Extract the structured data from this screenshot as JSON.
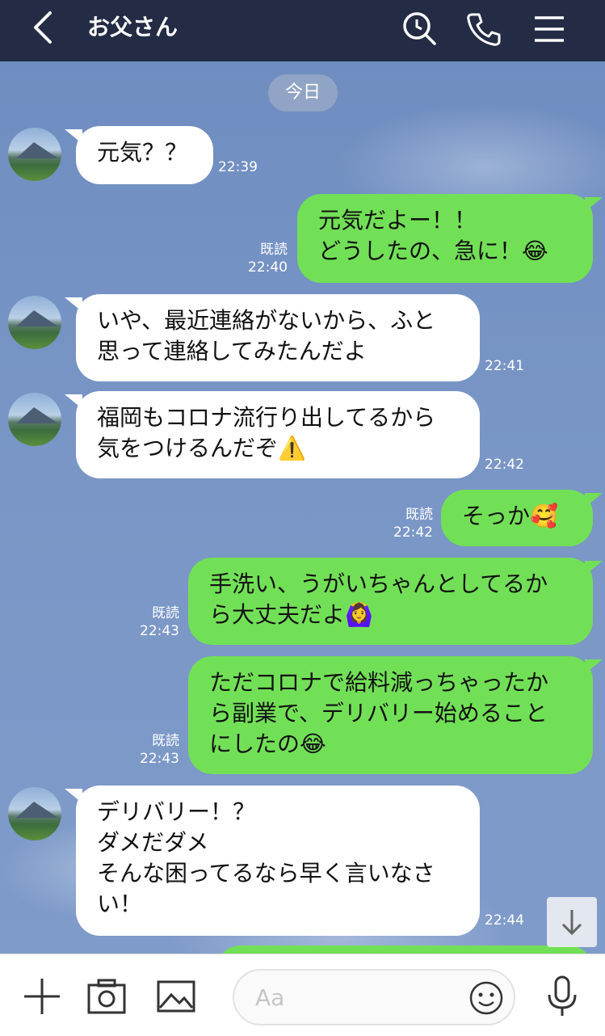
{
  "header": {
    "title": "お父さん",
    "bg_color": "#232c44"
  },
  "chat": {
    "date_label": "今日",
    "messages": [
      {
        "side": "in",
        "text": "元気？？",
        "time": "22:39"
      },
      {
        "side": "out",
        "text": "元気だよー！！\nどうしたの、急に！😂",
        "read": "既読",
        "time": "22:40"
      },
      {
        "side": "in",
        "text": "いや、最近連絡がないから、ふと\n思って連絡してみたんだよ",
        "time": "22:41"
      },
      {
        "side": "in",
        "text": "福岡もコロナ流行り出してるから\n気をつけるんだぞ⚠️",
        "time": "22:42"
      },
      {
        "side": "out",
        "text": "そっか🥰",
        "read": "既読",
        "time": "22:42"
      },
      {
        "side": "out",
        "text": "手洗い、うがいちゃんとしてるか\nら大丈夫だよ🙆‍♀️",
        "read": "既読",
        "time": "22:43"
      },
      {
        "side": "out",
        "text": "ただコロナで給料減っちゃったか\nら副業で、デリバリー始めること\nにしたの😂",
        "read": "既読",
        "time": "22:43"
      },
      {
        "side": "in",
        "text": "デリバリー！？\nダメだダメ\nそんな困ってるなら早く言いなさ\nい！",
        "time": "22:44"
      }
    ],
    "colors": {
      "incoming": "#ffffff",
      "outgoing": "#72e057"
    }
  },
  "input": {
    "placeholder": "Aa"
  },
  "icons": {
    "header": [
      "back-chevron-icon",
      "search-icon",
      "phone-icon",
      "menu-icon"
    ],
    "bottom": [
      "plus-icon",
      "camera-icon",
      "image-icon",
      "emoji-icon",
      "microphone-icon"
    ],
    "scroll": "arrow-down-icon"
  }
}
